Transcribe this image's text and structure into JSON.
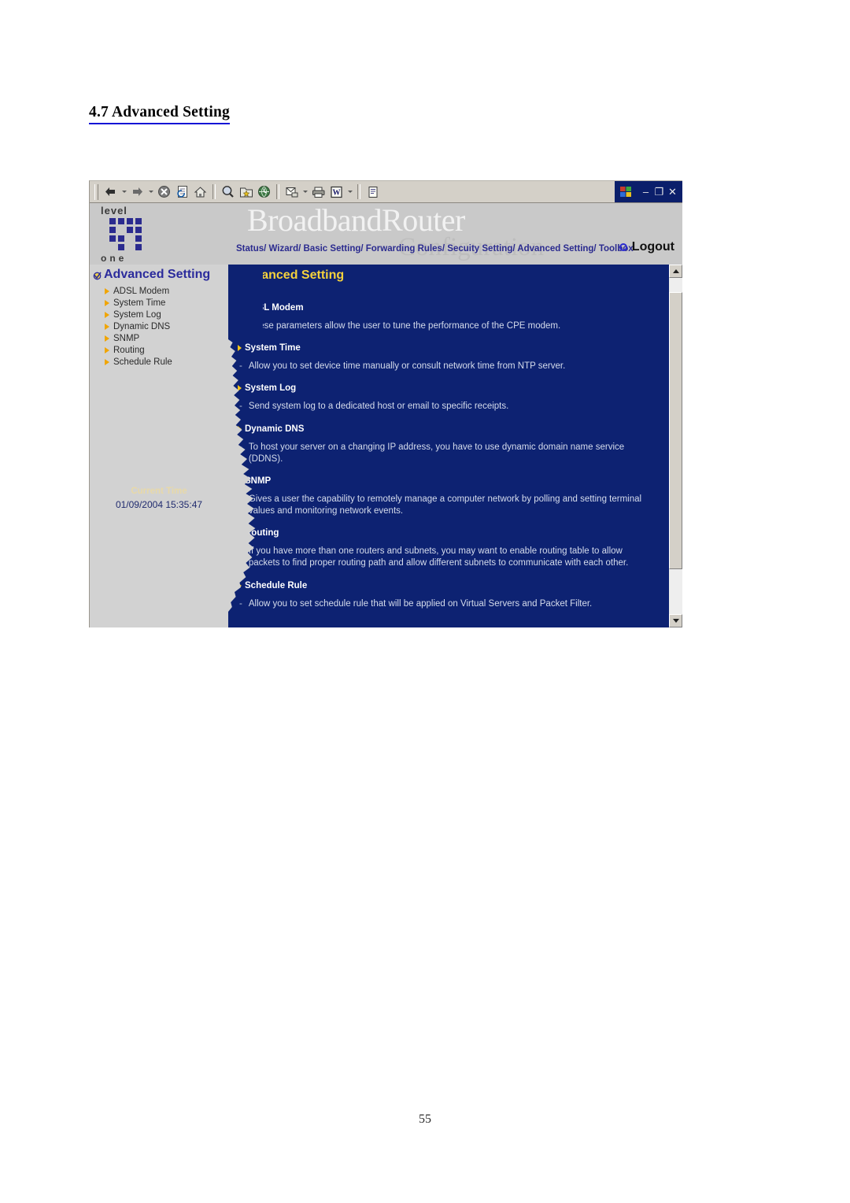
{
  "document": {
    "section_heading": "4.7 Advanced Setting",
    "page_number": "55"
  },
  "browser": {
    "toolbar_buttons": [
      {
        "name": "back-button",
        "icon": "back-arrow-icon"
      },
      {
        "name": "forward-button",
        "icon": "forward-arrow-icon"
      },
      {
        "name": "stop-button",
        "icon": "stop-icon"
      },
      {
        "name": "refresh-button",
        "icon": "refresh-icon"
      },
      {
        "name": "home-button",
        "icon": "home-icon"
      },
      {
        "name": "search-button",
        "icon": "search-icon"
      },
      {
        "name": "favorites-button",
        "icon": "favorites-star-folder-icon"
      },
      {
        "name": "history-button",
        "icon": "history-globe-icon"
      },
      {
        "name": "mail-button",
        "icon": "mail-icon"
      },
      {
        "name": "print-button",
        "icon": "printer-icon"
      },
      {
        "name": "edit-word-button",
        "icon": "word-w-icon"
      },
      {
        "name": "discuss-button",
        "icon": "document-icon"
      }
    ],
    "window_controls": {
      "minimize": "–",
      "restore": "❐",
      "close": "✕"
    }
  },
  "router_page": {
    "banner": {
      "brand_level": "level",
      "brand_one": "one",
      "title": "BroadbandRouter",
      "subtitle": "Configuration"
    },
    "nav": {
      "links": "Status/ Wizard/ Basic Setting/ Forwarding Rules/ Secuity Setting/ Advanced Setting/ Toolbox",
      "logout_label": "Logout"
    },
    "sidebar": {
      "title": "Advanced Setting",
      "items": [
        {
          "label": "ADSL Modem"
        },
        {
          "label": "System Time"
        },
        {
          "label": "System Log"
        },
        {
          "label": "Dynamic DNS"
        },
        {
          "label": "SNMP"
        },
        {
          "label": "Routing"
        },
        {
          "label": "Schedule Rule"
        }
      ],
      "current_time_label": "Current Time",
      "current_time_value": "01/09/2004 15:35:47"
    },
    "content": {
      "title": "Advanced Setting",
      "sections": [
        {
          "heading": "ADSL Modem",
          "dash": "-",
          "description": "These parameters allow the user to tune the performance of the CPE modem."
        },
        {
          "heading": "System Time",
          "dash": "-",
          "description": "Allow you to set device time manually or consult network time from NTP server."
        },
        {
          "heading": "System Log",
          "dash": "-",
          "description": "Send system log to a dedicated host or email to specific receipts."
        },
        {
          "heading": "Dynamic DNS",
          "dash": "-",
          "description": "To host your server on a changing IP address, you have to use dynamic domain name service (DDNS)."
        },
        {
          "heading": "SNMP",
          "dash": "-",
          "description": "Gives a user the capability to remotely manage a computer network by polling and setting terminal values and monitoring network events."
        },
        {
          "heading": "Routing",
          "dash": "-",
          "description": "If you have more than one routers and subnets, you may want to enable routing table to allow packets to find proper routing path and allow different subnets to communicate with each other."
        },
        {
          "heading": "Schedule Rule",
          "dash": "-",
          "description": "Allow you to set schedule rule that will be applied on Virtual Servers and Packet Filter."
        }
      ]
    }
  },
  "colors": {
    "content_bg": "#0d2272",
    "sidebar_bg": "#d2d2d2",
    "accent_yellow": "#f5d23c",
    "nav_blue": "#2b2b8f",
    "chrome_gray": "#d4d0c8"
  }
}
